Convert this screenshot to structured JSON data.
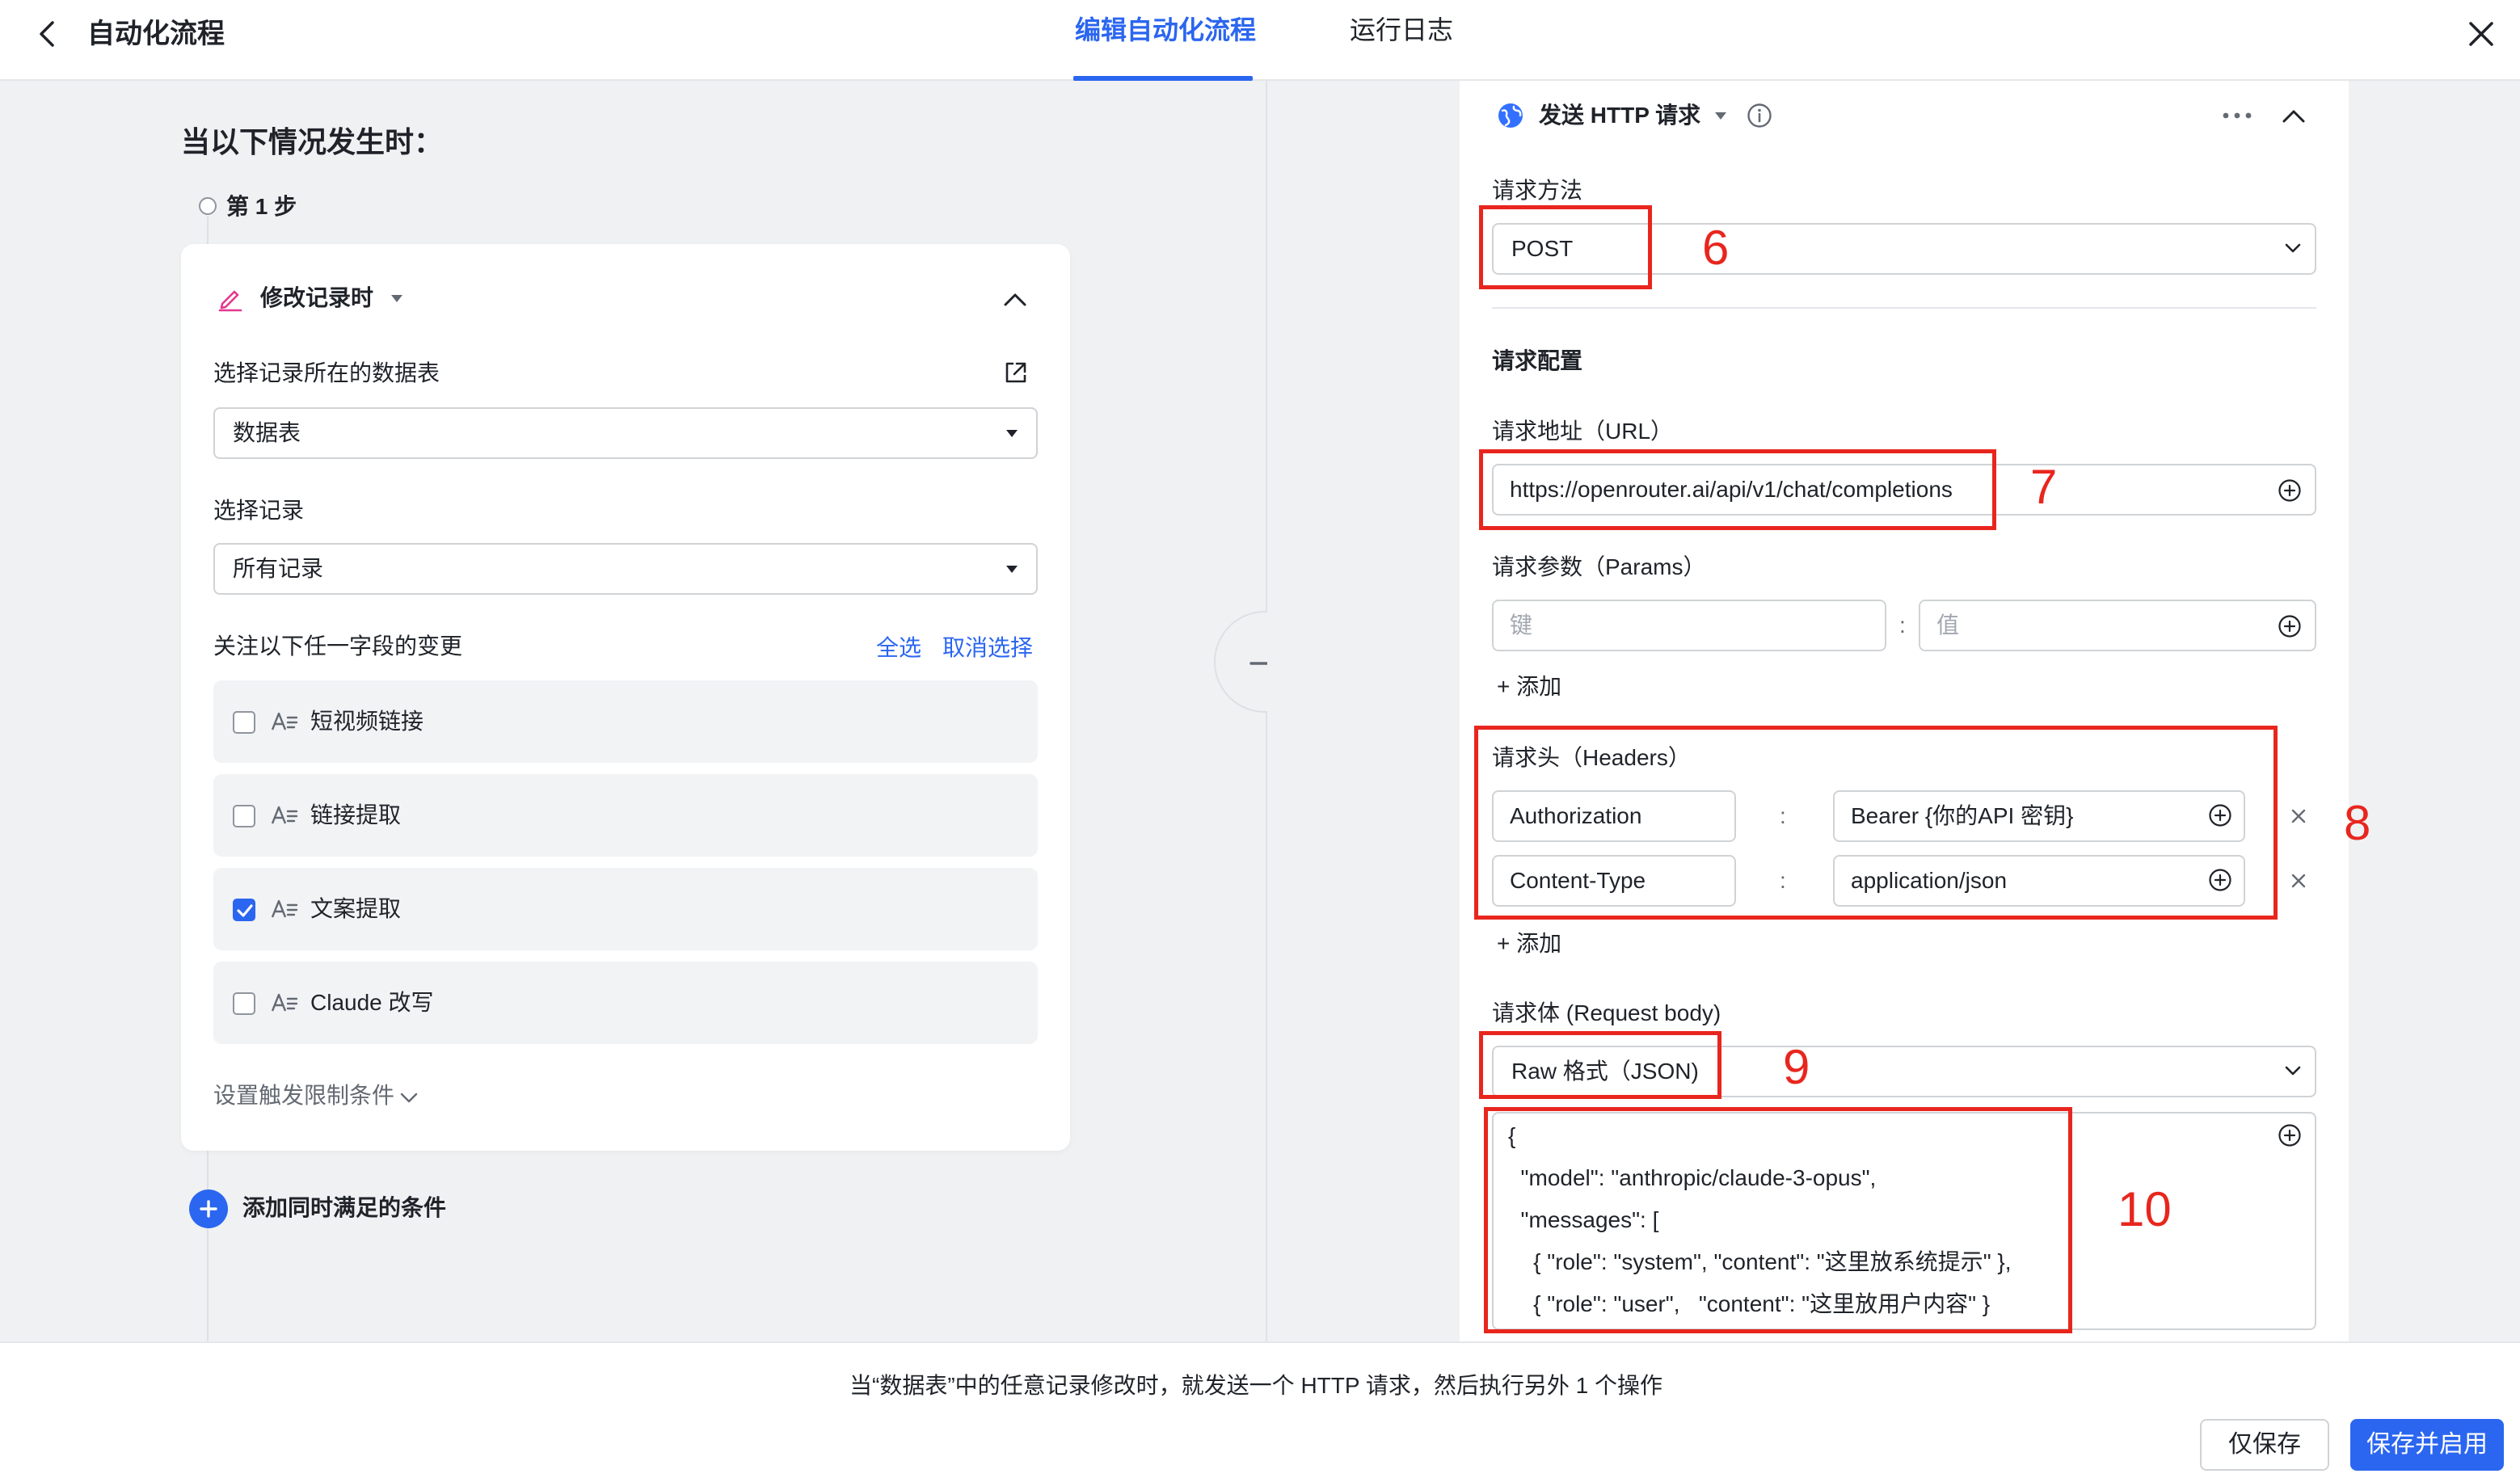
{
  "header": {
    "title": "自动化流程",
    "tabs": [
      {
        "label": "编辑自动化流程",
        "active": true
      },
      {
        "label": "运行日志",
        "active": false
      }
    ]
  },
  "trigger": {
    "heading": "当以下情况发生时：",
    "step_label": "第 1 步",
    "card_title": "修改记录时",
    "table_label": "选择记录所在的数据表",
    "table_value": "数据表",
    "record_label": "选择记录",
    "record_value": "所有记录",
    "watch_label": "关注以下任一字段的变更",
    "select_all": "全选",
    "deselect": "取消选择",
    "fields": [
      {
        "name": "短视频链接",
        "checked": false
      },
      {
        "name": "链接提取",
        "checked": false
      },
      {
        "name": "文案提取",
        "checked": true
      },
      {
        "name": "Claude 改写",
        "checked": false
      }
    ],
    "limit_label": "设置触发限制条件",
    "add_condition": "添加同时满足的条件"
  },
  "action": {
    "title": "发送 HTTP 请求",
    "method_label": "请求方法",
    "method_value": "POST",
    "config_title": "请求配置",
    "url_label": "请求地址（URL）",
    "url_value": "https://openrouter.ai/api/v1/chat/completions",
    "params_label": "请求参数（Params）",
    "params_key_placeholder": "键",
    "params_value_placeholder": "值",
    "add_label": "+ 添加",
    "headers_label": "请求头（Headers）",
    "headers": [
      {
        "key": "Authorization",
        "value": "Bearer {你的API 密钥}"
      },
      {
        "key": "Content-Type",
        "value": "application/json"
      }
    ],
    "colon": ":",
    "body_label": "请求体 (Request body)",
    "body_format": "Raw 格式（JSON)",
    "body_lines": [
      "{",
      "  \"model\": \"anthropic/claude-3-opus\",",
      "  \"messages\": [",
      "    { \"role\": \"system\", \"content\": \"这里放系统提示\" },",
      "    { \"role\": \"user\",   \"content\": \"这里放用户内容\" }"
    ]
  },
  "annotations": [
    "6",
    "7",
    "8",
    "9",
    "10"
  ],
  "footer": {
    "description": "当“数据表”中的任意记录修改时，就发送一个 HTTP 请求，然后执行另外 1 个操作",
    "save_only": "仅保存",
    "save_enable": "保存并启用"
  },
  "colors": {
    "accent": "#2b66f0",
    "annotation": "#e8261e"
  }
}
